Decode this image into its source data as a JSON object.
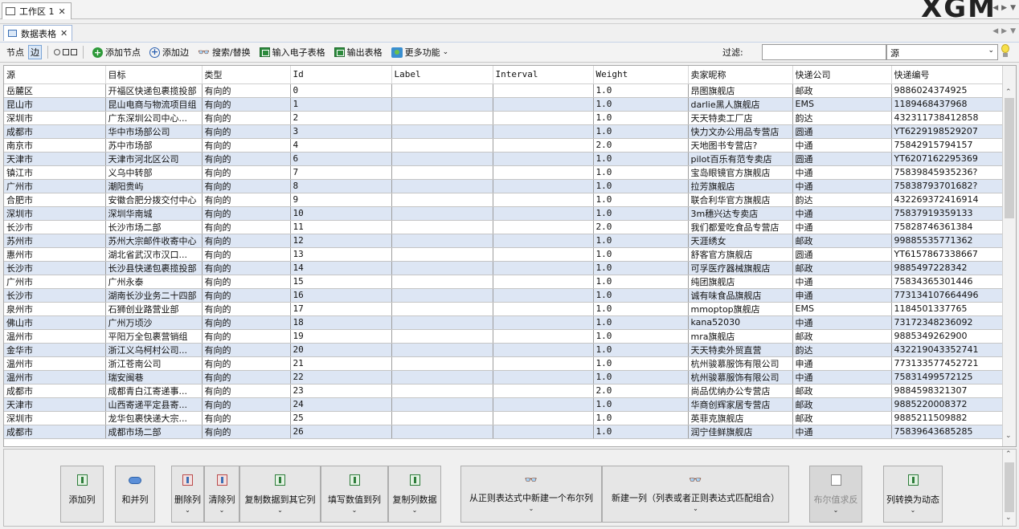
{
  "workspace": {
    "tab_label": "工作区 1",
    "logo_text": "XGM"
  },
  "panel": {
    "tab_label": "数据表格"
  },
  "toolbar": {
    "nodes_label": "节点",
    "edges_label": "边",
    "add_node": "添加节点",
    "add_edge": "添加边",
    "search_replace": "搜索/替换",
    "import_spreadsheet": "输入电子表格",
    "export_table": "输出表格",
    "more_functions": "更多功能",
    "filter_label": "过滤:",
    "filter_value": "",
    "filter_column": "源"
  },
  "table": {
    "columns": [
      "源",
      "目标",
      "类型",
      "Id",
      "Label",
      "Interval",
      "Weight",
      "卖家昵称",
      "快递公司",
      "快递编号"
    ],
    "rows": [
      [
        "岳麓区",
        "开福区快递包裹揽投部",
        "有向的",
        "0",
        "",
        "",
        "1.0",
        "昂图旗舰店",
        "邮政",
        "9886024374925"
      ],
      [
        "昆山市",
        "昆山电商与物流项目组",
        "有向的",
        "1",
        "",
        "",
        "1.0",
        "darlie黑人旗舰店",
        "EMS",
        "1189468437968"
      ],
      [
        "深圳市",
        "广东深圳公司中心...",
        "有向的",
        "2",
        "",
        "",
        "1.0",
        "天天特卖工厂店",
        "韵达",
        "432311738412858"
      ],
      [
        "成都市",
        "华中市场部公司",
        "有向的",
        "3",
        "",
        "",
        "1.0",
        "快力文办公用品专营店",
        "圆通",
        "YT6229198529207"
      ],
      [
        "南京市",
        "苏中市场部",
        "有向的",
        "4",
        "",
        "",
        "2.0",
        "天地图书专营店?",
        "中通",
        "75842915794157"
      ],
      [
        "天津市",
        "天津市河北区公司",
        "有向的",
        "6",
        "",
        "",
        "1.0",
        "pilot百乐有范专卖店",
        "圆通",
        "YT6207162295369"
      ],
      [
        "镇江市",
        "义乌中转部",
        "有向的",
        "7",
        "",
        "",
        "1.0",
        "宝岛眼镜官方旗舰店",
        "中通",
        "75839845935236?"
      ],
      [
        "广州市",
        "潮阳贵屿",
        "有向的",
        "8",
        "",
        "",
        "1.0",
        "拉芳旗舰店",
        "中通",
        "75838793701682?"
      ],
      [
        "合肥市",
        "安徽合肥分拨交付中心",
        "有向的",
        "9",
        "",
        "",
        "1.0",
        "联合利华官方旗舰店",
        "韵达",
        "432269372416914"
      ],
      [
        "深圳市",
        "深圳华南城",
        "有向的",
        "10",
        "",
        "",
        "1.0",
        "3m穗兴达专卖店",
        "中通",
        "75837919359133"
      ],
      [
        "长沙市",
        "长沙市场二部",
        "有向的",
        "11",
        "",
        "",
        "2.0",
        "我们都爱吃食品专营店",
        "中通",
        "75828746361384"
      ],
      [
        "苏州市",
        "苏州大宗邮件收寄中心",
        "有向的",
        "12",
        "",
        "",
        "1.0",
        "天涯绣女",
        "邮政",
        "99885535771362"
      ],
      [
        "惠州市",
        "湖北省武汉市汉口...",
        "有向的",
        "13",
        "",
        "",
        "1.0",
        "舒客官方旗舰店",
        "圆通",
        "YT6157867338667"
      ],
      [
        "长沙市",
        "长沙县快递包裹揽投部",
        "有向的",
        "14",
        "",
        "",
        "1.0",
        "可孚医疗器械旗舰店",
        "邮政",
        "9885497228342"
      ],
      [
        "广州市",
        "广州永泰",
        "有向的",
        "15",
        "",
        "",
        "1.0",
        "纯团旗舰店",
        "中通",
        "75834365301446"
      ],
      [
        "长沙市",
        "湖南长沙业务二十四部",
        "有向的",
        "16",
        "",
        "",
        "1.0",
        "诚有味食品旗舰店",
        "申通",
        "773134107664496"
      ],
      [
        "泉州市",
        "石狮创业路营业部",
        "有向的",
        "17",
        "",
        "",
        "1.0",
        "mmoptop旗舰店",
        "EMS",
        "1184501337765"
      ],
      [
        "佛山市",
        "广州万顷沙",
        "有向的",
        "18",
        "",
        "",
        "1.0",
        "kana52030",
        "中通",
        "73172348236092"
      ],
      [
        "温州市",
        "平阳万全包裹营销组",
        "有向的",
        "19",
        "",
        "",
        "1.0",
        "mra旗舰店",
        "邮政",
        "9885349262900"
      ],
      [
        "金华市",
        "浙江义乌柯村公司...",
        "有向的",
        "20",
        "",
        "",
        "1.0",
        "天天特卖外贸直营",
        "韵达",
        "432219043352741"
      ],
      [
        "温州市",
        "浙江苍南公司",
        "有向的",
        "21",
        "",
        "",
        "1.0",
        "杭州骏慕服饰有限公司",
        "申通",
        "773133577452721"
      ],
      [
        "温州市",
        "瑞安闽巷",
        "有向的",
        "22",
        "",
        "",
        "1.0",
        "杭州骏慕服饰有限公司",
        "中通",
        "75831499572125"
      ],
      [
        "成都市",
        "成都青白江寄递事...",
        "有向的",
        "23",
        "",
        "",
        "2.0",
        "尚品优纳办公专营店",
        "邮政",
        "9884598321307"
      ],
      [
        "天津市",
        "山西寄递平定县寄...",
        "有向的",
        "24",
        "",
        "",
        "1.0",
        "华商创辉家居专营店",
        "邮政",
        "9885220008372"
      ],
      [
        "深圳市",
        "龙华包裹快递大宗...",
        "有向的",
        "25",
        "",
        "",
        "1.0",
        "英菲克旗舰店",
        "邮政",
        "9885211509882"
      ],
      [
        "成都市",
        "成都市场二部",
        "有向的",
        "26",
        "",
        "",
        "1.0",
        "润宁佳鲜旗舰店",
        "中通",
        "75839643685285"
      ]
    ]
  },
  "bottom_buttons": {
    "add_column": "添加列",
    "merge_columns": "和并列",
    "delete_column": "删除列",
    "clear_column": "清除列",
    "copy_to_other": "复制数据到其它列",
    "fill_values": "填写数值到列",
    "copy_column": "复制列数据",
    "regex_boolean": "从正则表达式中新建一个布尔列",
    "new_column_regex": "新建一列（列表或者正则表达式匹配组合）",
    "boolean_negate": "布尔值求反",
    "to_dynamic": "列转换为动态"
  }
}
